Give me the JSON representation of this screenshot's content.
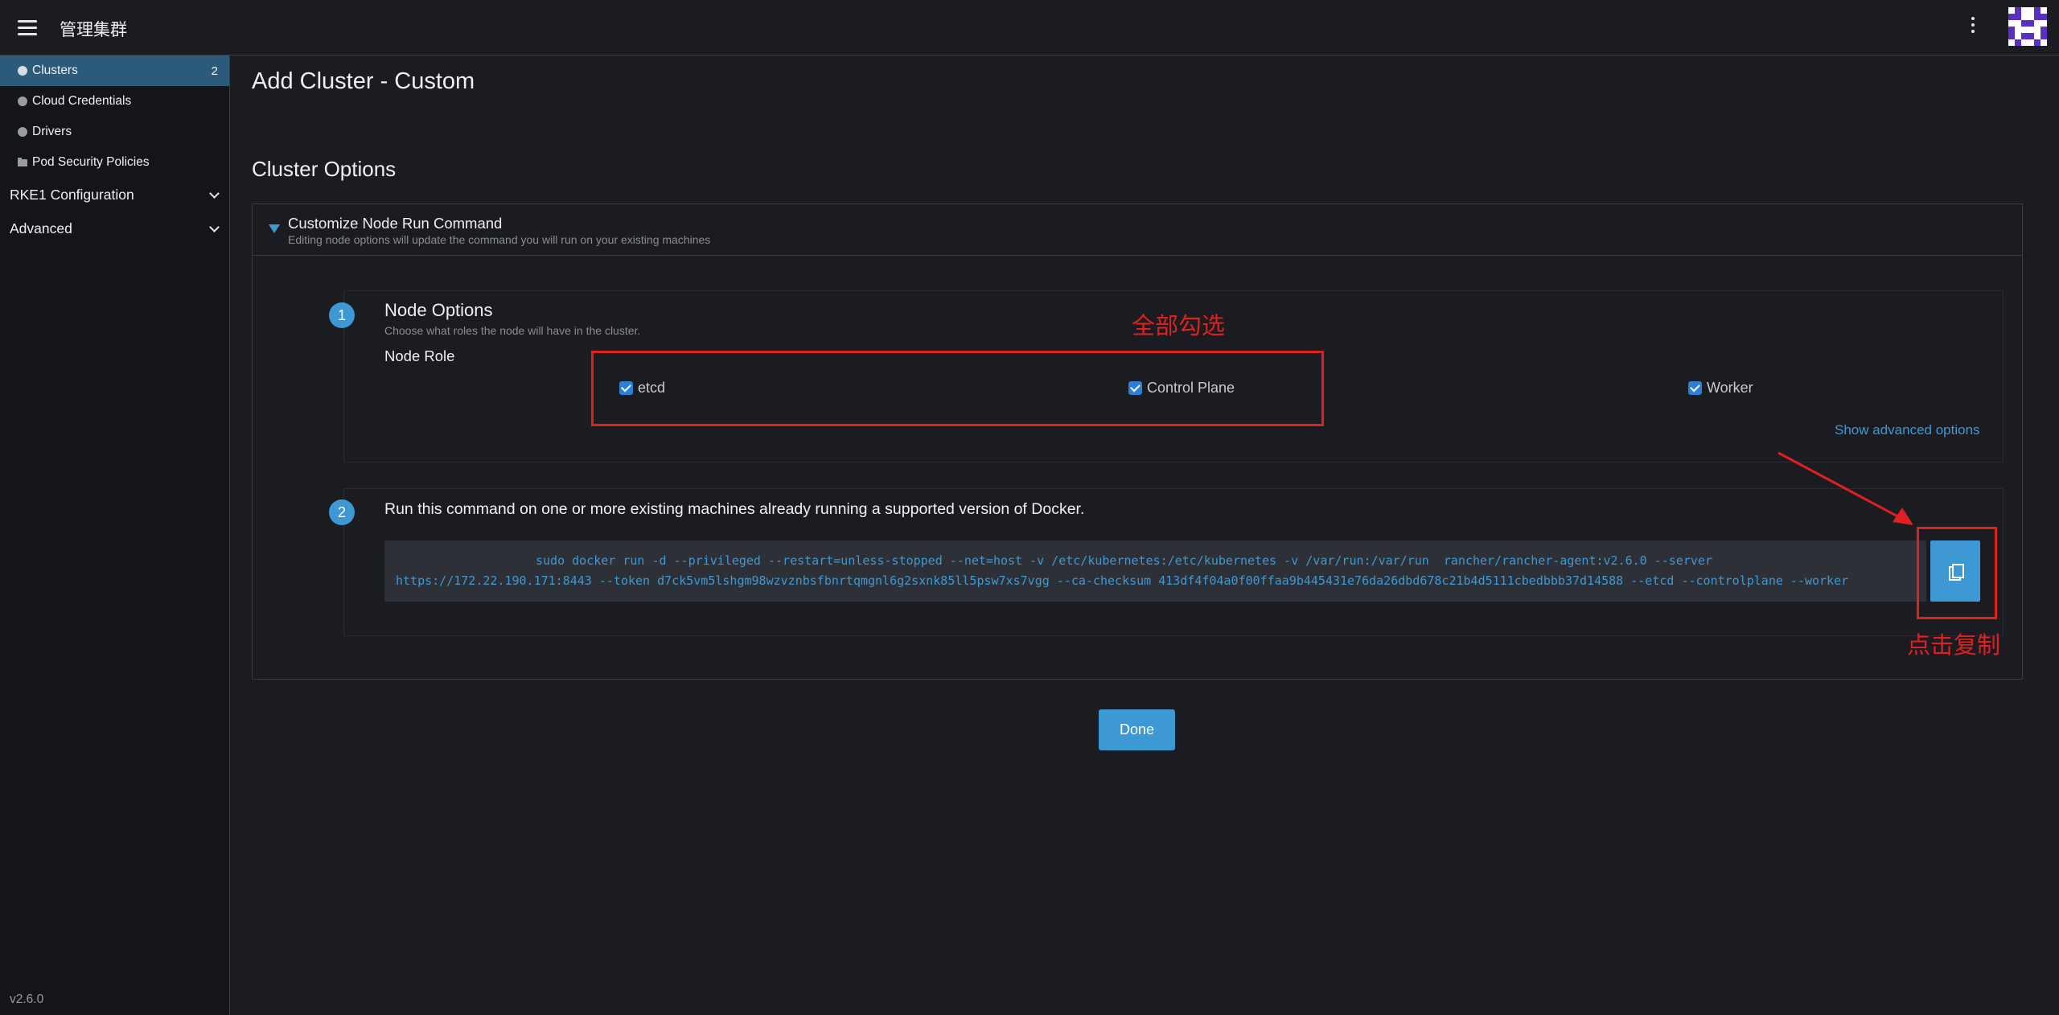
{
  "header": {
    "title": "管理集群"
  },
  "sidebar": {
    "items": [
      {
        "label": "Clusters",
        "count": "2"
      },
      {
        "label": "Cloud Credentials"
      },
      {
        "label": "Drivers"
      },
      {
        "label": "Pod Security Policies"
      }
    ],
    "groups": [
      {
        "label": "RKE1 Configuration"
      },
      {
        "label": "Advanced"
      }
    ],
    "version": "v2.6.0"
  },
  "main": {
    "page_title": "Add Cluster - Custom",
    "section_title": "Cluster Options",
    "panel": {
      "title": "Customize Node Run Command",
      "subtitle": "Editing node options will update the command you will run on your existing machines"
    },
    "step1": {
      "number": "1",
      "title": "Node Options",
      "subtitle": "Choose what roles the node will have in the cluster.",
      "role_label": "Node Role",
      "roles": [
        {
          "label": "etcd",
          "checked": true
        },
        {
          "label": "Control Plane",
          "checked": true
        },
        {
          "label": "Worker",
          "checked": true
        }
      ],
      "advanced_link": "Show advanced options"
    },
    "step2": {
      "number": "2",
      "title": "Run this command on one or more existing machines already running a supported version of Docker.",
      "command_line1": "sudo docker run -d --privileged --restart=unless-stopped --net=host -v /etc/kubernetes:/etc/kubernetes -v /var/run:/var/run  rancher/rancher-agent:v2.6.0 --server",
      "command_line2": "https://172.22.190.171:8443 --token d7ck5vm5lshgm98wzvznbsfbnrtqmgnl6g2sxnk85ll5psw7xs7vgg --ca-checksum 413df4f04a0f00ffaa9b445431e76da26dbd678c21b4d5111cbedbbb37d14588 --etcd --controlplane --worker"
    },
    "done_label": "Done"
  },
  "annotations": {
    "select_all": "全部勾选",
    "click_copy": "点击复制"
  },
  "colors": {
    "accent": "#3d98d3",
    "annotation": "#e02020"
  }
}
